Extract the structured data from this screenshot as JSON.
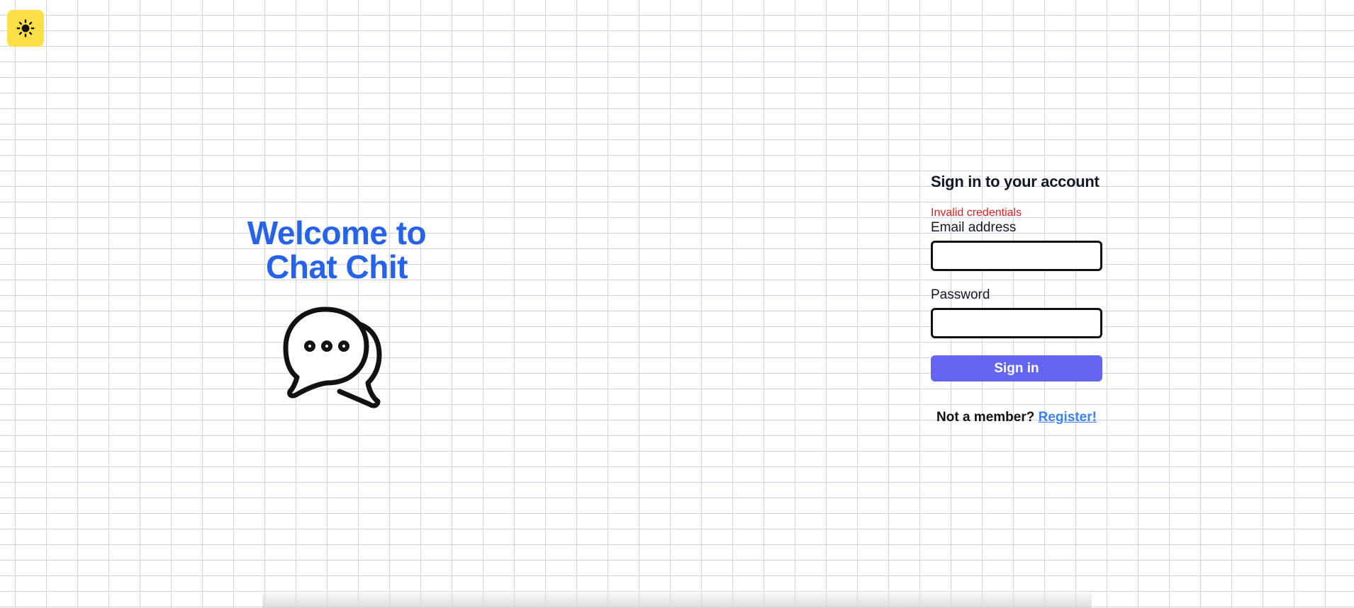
{
  "theme_toggle": {
    "icon": "sun-icon",
    "color": "#fde047"
  },
  "hero": {
    "title_line1": "Welcome to",
    "title_line2": "Chat Chit",
    "logo_icon": "chat-bubbles-icon",
    "title_color": "#2563eb"
  },
  "signin": {
    "title": "Sign in to your account",
    "error": "Invalid credentials",
    "email_label": "Email address",
    "email_value": "",
    "password_label": "Password",
    "password_value": "",
    "submit_label": "Sign in",
    "submit_color": "#6366f1",
    "register_prompt": "Not a member?",
    "register_link": "Register!"
  }
}
